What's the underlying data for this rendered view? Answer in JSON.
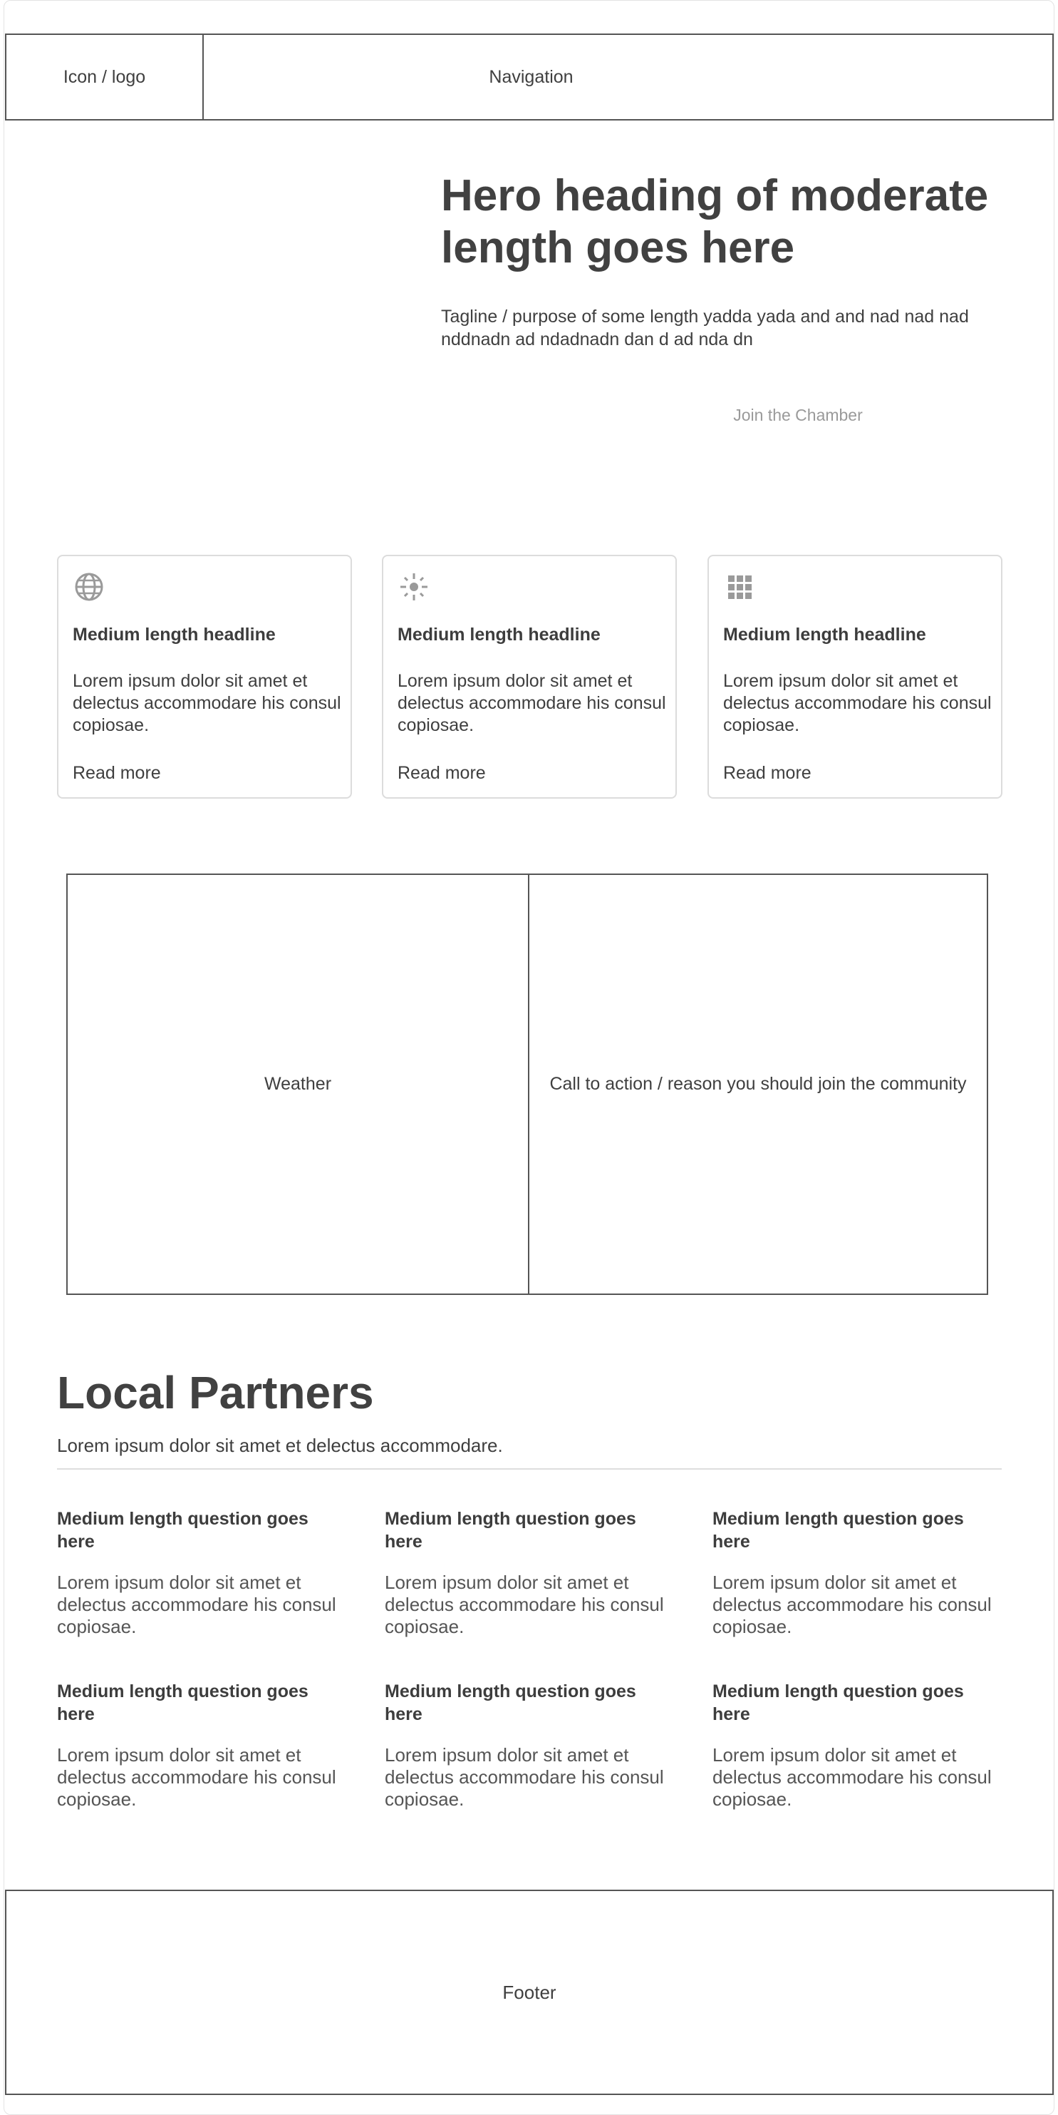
{
  "header": {
    "logo_label": "Icon / logo",
    "nav_label": "Navigation"
  },
  "hero": {
    "heading": "Hero heading of moderate length goes here",
    "tagline": "Tagline / purpose of some length yadda yada and and nad nad nad nddnadn ad ndadnadn dan d ad nda dn",
    "cta_label": "Join the Chamber"
  },
  "features": [
    {
      "icon": "globe-icon",
      "title": "Medium length headline",
      "body": "Lorem ipsum dolor sit amet et delectus accommodare his consul copiosae.",
      "link": "Read more"
    },
    {
      "icon": "sun-icon",
      "title": "Medium length headline",
      "body": "Lorem ipsum dolor sit amet et delectus accommodare his consul copiosae.",
      "link": "Read more"
    },
    {
      "icon": "grid-icon",
      "title": "Medium length headline",
      "body": "Lorem ipsum dolor sit amet et delectus accommodare his consul copiosae.",
      "link": "Read more"
    }
  ],
  "split": {
    "left_label": "Weather",
    "right_label": "Call to action / reason you should join the community"
  },
  "partners": {
    "title": "Local Partners",
    "subtitle": "Lorem ipsum dolor sit amet et delectus accommodare.",
    "items": [
      {
        "question": "Medium length question goes here",
        "answer": "Lorem ipsum dolor sit amet et delectus accommodare his consul copiosae."
      },
      {
        "question": "Medium length question goes here",
        "answer": "Lorem ipsum dolor sit amet et delectus accommodare his consul copiosae."
      },
      {
        "question": "Medium length question goes here",
        "answer": "Lorem ipsum dolor sit amet et delectus accommodare his consul copiosae."
      },
      {
        "question": "Medium length question goes here",
        "answer": "Lorem ipsum dolor sit amet et delectus accommodare his consul copiosae."
      },
      {
        "question": "Medium length question goes here",
        "answer": "Lorem ipsum dolor sit amet et delectus accommodare his consul copiosae."
      },
      {
        "question": "Medium length question goes here",
        "answer": "Lorem ipsum dolor sit amet et delectus accommodare his consul copiosae."
      }
    ]
  },
  "footer": {
    "label": "Footer"
  },
  "colors": {
    "text": "#3f3f3f",
    "border": "#555555",
    "card_border": "#dcdcdc",
    "icon": "#9a9a9a",
    "cta_text": "#9a9a9a"
  }
}
